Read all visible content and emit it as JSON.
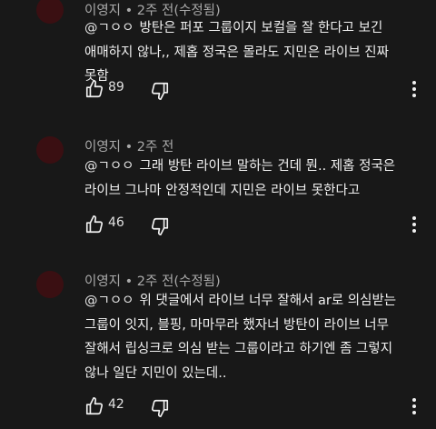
{
  "comments": [
    {
      "author": "이영지",
      "time": "• 2주 전(수정됨)",
      "mention": "@ㄱㅇㅇ",
      "text": "방탄은 퍼포 그룹이지 보컬을 잘 한다고 보긴 애매하지 않나,, 제홉 정국은 몰라도 지민은 라이브 진짜 못함",
      "likes": "89"
    },
    {
      "author": "이영지",
      "time": "• 2주 전",
      "mention": "@ㄱㅇㅇ",
      "text": "그래 방탄 라이브 말하는 건데 뭔.. 제홉 정국은 라이브 그나마 안정적인데 지민은 라이브 못한다고",
      "likes": "46"
    },
    {
      "author": "이영지",
      "time": "• 2주 전(수정됨)",
      "mention": "@ㄱㅇㅇ",
      "text": "위 댓글에서 라이브 너무 잘해서 ar로 의심받는 그룹이 잇지, 블핑, 마마무라 했자너 방탄이 라이브 너무 잘해서 립싱크로 의심 받는 그룹이라고 하기엔 좀 그렇지 않나 일단 지민이 있는데..",
      "likes": "42"
    }
  ],
  "icons": {
    "like": "thumb-up-icon",
    "dislike": "thumb-down-icon",
    "more": "more-vert-icon"
  },
  "colors": {
    "background": "#181818",
    "avatar": "#3a0f12",
    "meta_text": "#aaaaaa",
    "body_text": "#f1f1f1"
  }
}
